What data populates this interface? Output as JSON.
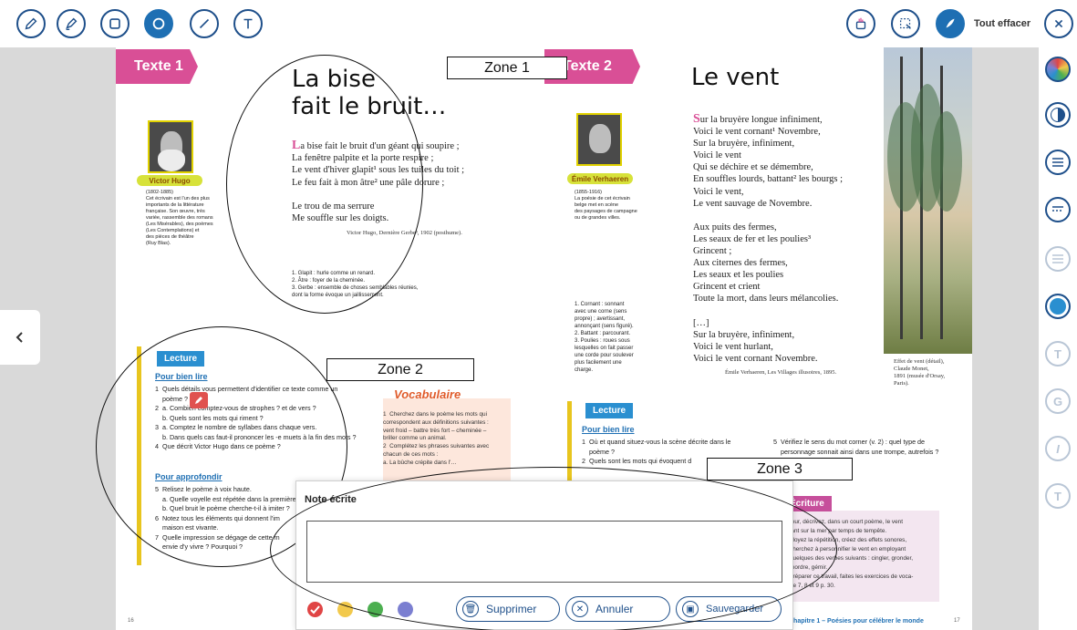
{
  "toolbar": {
    "tools": [
      "pencil-icon",
      "highlighter-icon",
      "rectangle-icon",
      "circle-icon",
      "line-icon",
      "text-icon"
    ],
    "active_tool": "circle-icon",
    "right_tools": [
      "paint-cup-icon",
      "select-area-icon",
      "feather-icon"
    ],
    "clear_all_label": "Tout effacer",
    "colors": {
      "primary": "#1e4f8a",
      "active": "#1e6fb3"
    }
  },
  "side_tools": [
    "color-wheel-icon",
    "opacity-icon",
    "line-weight-icon",
    "dash-style-icon",
    "line-style-faded-icon",
    "fill-color-icon",
    "text-size-icon",
    "bold-icon",
    "italic-icon",
    "text-style-icon"
  ],
  "left_page": {
    "tab": "Texte 1",
    "title_line1": "La bise",
    "title_line2": "fait le bruit…",
    "dropcap": "L",
    "poem": "a bise fait le bruit d'un géant qui soupire ;\nLa fenêtre palpite et la porte respire ;\nLe vent d'hiver glapit¹ sous les tuiles du toit ;\nLe feu fait à mon âtre² une pâle dorure ;\n\nLe trou de ma serrure\nMe souffle sur les doigts.",
    "credit": "Victor Hugo, Dernière Gerbe³, 1902 (posthume).",
    "footnotes": "1. Glapit : hurle comme un renard.\n2. Âtre : foyer de la cheminée.\n3. Gerbe : ensemble de choses semblables réunies,\ndont la forme évoque un jaillissement.",
    "author_name": "Victor Hugo",
    "author_bio": "(1802-1885)\nCet écrivain est l'un des plus\nimportants de la littérature\nfrançaise. Son œuvre, très\nvariée, rassemble des romans\n(Les Misérables), des poèmes\n(Les Contemplations) et\ndes pièces de théâtre\n(Ruy Blas).",
    "lecture_label": "Lecture",
    "pour_bien_lire": "Pour bien lire",
    "questions_1": "1  Quels détails vous permettent d'identifier ce texte comme un\n    poème ?\n2  a. Combien comptez-vous de strophes ? et de vers ?\n    b. Quels sont les mots qui riment ?\n3  a. Comptez le nombre de syllabes dans chaque vers.\n    b. Dans quels cas faut-il prononcer les -e muets à la fin des mots ?\n4  Que décrit Victor Hugo dans ce poème ?",
    "pour_approfondir": "Pour approfondir",
    "questions_2": "5  Relisez le poème à voix haute.\n    a. Quelle voyelle est répétée dans la première\n    b. Quel bruit le poème cherche-t-il à imiter ?\n6  Notez tous les éléments qui donnent l'im\n    maison est vivante.\n7  Quelle impression se dégage de cette m\n    envie d'y vivre ? Pourquoi ?",
    "vocab_title": "Vocabulaire",
    "vocab_text": "1  Cherchez dans le poème les mots qui\ncorrespondent aux définitions suivantes :\nvent froid – battre très fort – cheminée –\nbriller comme un animal.\n2  Complétez les phrases suivantes avec\nchacun de ces mots :\na. La bûche crépite dans l'…",
    "page_number": "16"
  },
  "right_page": {
    "tab": "Texte 2",
    "title": "Le vent",
    "dropcap": "S",
    "poem": "ur la bruyère longue infiniment,\nVoici le vent cornant¹ Novembre,\nSur la bruyère, infiniment,\nVoici le vent\nQui se déchire et se démembre,\nEn souffles lourds, battant² les bourgs ;\nVoici le vent,\nLe vent sauvage de Novembre.\n\nAux puits des fermes,\nLes seaux de fer et les poulies³\nGrincent ;\nAux citernes des fermes,\nLes seaux et les poulies\nGrincent et crient\nToute la mort, dans leurs mélancolies.\n\n[…]\nSur la bruyère, infiniment,\nVoici le vent hurlant,\nVoici le vent cornant Novembre.",
    "credit": "Émile Verhaeren, Les Villages illusoires, 1895.",
    "footnotes": "1. Cornant : sonnant\navec une corne (sens\npropre) ; avertissant,\nannonçant (sens figuré).\n2. Battant : parcourant.\n3. Poulies : roues sous\nlesquelles on fait passer\nune corde pour soulever\nplus facilement une\ncharge.",
    "author_name": "Émile Verhaeren",
    "author_bio": "(1855-1916)\nLa poésie de cet écrivain\nbelge met en scène\ndes paysages de campagne\nou de grandes villes.",
    "painting_caption": "Effet de vent (détail),\nClaude Monet,\n1891 (musée d'Orsay,\nParis).",
    "lecture_label": "Lecture",
    "pour_bien_lire": "Pour bien lire",
    "questions_a": "1  Où et quand situez-vous la scène décrite dans le\n    poème ?\n2  Quels sont les mots qui évoquent d",
    "questions_b": "5  Vérifiez le sens du mot corner (v. 2) : quel type de\n    personnage sonnait ainsi dans une trompe, autrefois ?\n    le vent dans ce poème ?",
    "ecriture_label": "Écriture",
    "ecriture_text": "tour, décrivez, dans un court poème, le vent\nlant sur la mer par temps de tempête.\nployez la répétition, créez des effets sonores,\ncherchez à personnifier le vent en employant\nquelques des verbes suivants : cingler, gronder,\nmordre, gémir.\npréparer ce travail, faites les exercices de voca-\nire 7, 8 et 9 p. 30.",
    "footer": "Chapitre 1 – Poésies pour célébrer le monde",
    "page_number": "17"
  },
  "zones": {
    "zone1": "Zone 1",
    "zone2": "Zone 2",
    "zone3": "Zone 3"
  },
  "note": {
    "title": "Note écrite",
    "placeholder": "",
    "colors": [
      "#e04545",
      "#f2c94c",
      "#4caf50",
      "#7b7fd1"
    ],
    "delete_label": "Supprimer",
    "cancel_label": "Annuler",
    "save_label": "Sauvegarder"
  }
}
